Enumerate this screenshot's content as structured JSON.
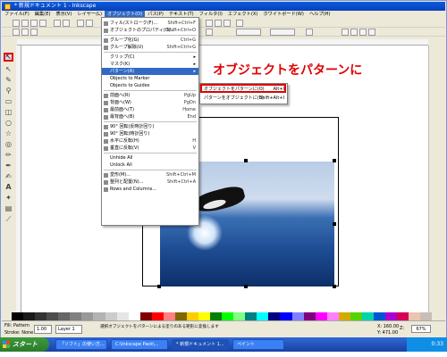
{
  "window": {
    "title": "* 新規ドキュメント 1 - Inkscape"
  },
  "menubar": {
    "items": [
      "ファイル(F)",
      "編集(E)",
      "表示(V)",
      "レイヤー(L)",
      "オブジェクト(O)",
      "パス(P)",
      "テキスト(T)",
      "フィルタ(I)",
      "エフェクト(X)",
      "ホワイトボード(W)",
      "ヘルプ(H)"
    ]
  },
  "object_menu": {
    "items": [
      {
        "label": "フィル/ストローク(F)...",
        "shortcut": "Shift+Ctrl+F"
      },
      {
        "label": "オブジェクトのプロパティ(O)...",
        "shortcut": "Shift+Ctrl+O"
      },
      {
        "label": "グループ化(G)",
        "shortcut": "Ctrl+G"
      },
      {
        "label": "グループ解除(U)",
        "shortcut": "Shift+Ctrl+G"
      },
      {
        "label": "クリップ(C)",
        "shortcut": ""
      },
      {
        "label": "マスク(K)",
        "shortcut": ""
      },
      {
        "label": "パターン(A)",
        "shortcut": ""
      },
      {
        "label": "Objects to Marker",
        "shortcut": ""
      },
      {
        "label": "Objects to Guides",
        "shortcut": ""
      },
      {
        "label": "前面へ(R)",
        "shortcut": "PgUp"
      },
      {
        "label": "背面へ(W)",
        "shortcut": "PgDn"
      },
      {
        "label": "最前面へ(T)",
        "shortcut": "Home"
      },
      {
        "label": "最背面へ(B)",
        "shortcut": "End"
      },
      {
        "label": "90° 回転(反時計回り)",
        "shortcut": ""
      },
      {
        "label": "90° 回転(時計回り)",
        "shortcut": ""
      },
      {
        "label": "水平に反転(H)",
        "shortcut": "H"
      },
      {
        "label": "垂直に反転(V)",
        "shortcut": "V"
      },
      {
        "label": "Unhide All",
        "shortcut": ""
      },
      {
        "label": "Unlock All",
        "shortcut": ""
      },
      {
        "label": "変形(M)...",
        "shortcut": "Shift+Ctrl+M"
      },
      {
        "label": "整列と配置(N)...",
        "shortcut": "Shift+Ctrl+A"
      },
      {
        "label": "Rows and Columns...",
        "shortcut": ""
      }
    ]
  },
  "pattern_submenu": {
    "items": [
      {
        "label": "オブジェクトをパターンに(O)",
        "shortcut": "Alt+I"
      },
      {
        "label": "パターンをオブジェクトに(B)",
        "shortcut": "Shift+Alt+I"
      }
    ]
  },
  "callout": {
    "text": "オブジェクトをパターンに"
  },
  "statusbar": {
    "fill_label": "Fill:",
    "fill_value": "Pattern",
    "stroke_label": "Stroke:",
    "stroke_value": "None",
    "opacity": "1.00",
    "layer": "Layer 1",
    "message": "選択オブジェクトをパターンによる塗りのある矩形に変換します",
    "x": "X: 160.00",
    "y": "Y: 471.00",
    "zoom_label": "Z:",
    "zoom": "67%"
  },
  "taskbar": {
    "start": "スタート",
    "tasks": [
      "「ソフト」の使い方...",
      "C:\\Inkscape Pack\\...",
      "* 新規ドキュメント 1...",
      "ペイント"
    ],
    "clock": "0:33"
  },
  "colors": {
    "accent": "#316ac5",
    "highlight": "#e00000",
    "titlebar": "#0a5ee0"
  }
}
